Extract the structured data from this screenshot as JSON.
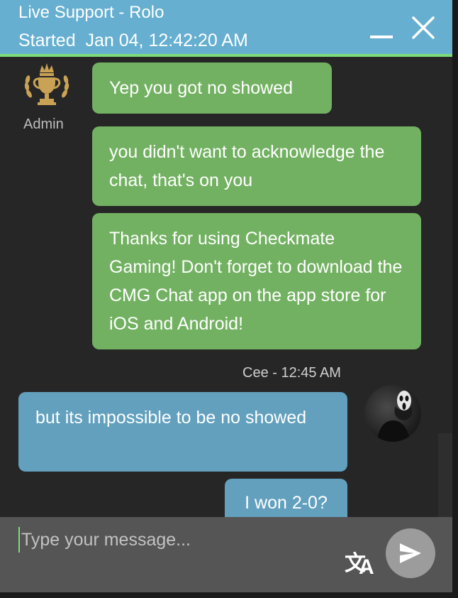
{
  "header": {
    "title": "Live Support - Rolo",
    "started": "Started  Jan 04, 12:42:20 AM"
  },
  "admin": {
    "label": "Admin",
    "avatar_icon": "trophy-icon"
  },
  "messages": [
    {
      "from": "admin",
      "text": "Yep you got no showed"
    },
    {
      "from": "admin",
      "text": "you didn't want to acknowledge the chat, that's on you"
    },
    {
      "from": "admin",
      "text": "Thanks for using Checkmate Gaming! Don't forget to download the CMG Chat app on the app store for iOS and Android!"
    },
    {
      "from": "user",
      "text": "but its impossible to be no showed"
    },
    {
      "from": "user",
      "text": "I won 2-0?"
    }
  ],
  "user_meta": "Cee - 12:45 AM",
  "composer": {
    "placeholder": "Type your message..."
  },
  "icons": {
    "minimize": "minimize-icon",
    "close": "close-icon",
    "translate": "translate-icon",
    "send": "send-icon"
  },
  "colors": {
    "header": "#66afd0",
    "accent": "#7ddc7a",
    "admin_bubble": "#73b162",
    "user_bubble": "#62a0be",
    "background": "#262626",
    "composer": "#555555"
  }
}
